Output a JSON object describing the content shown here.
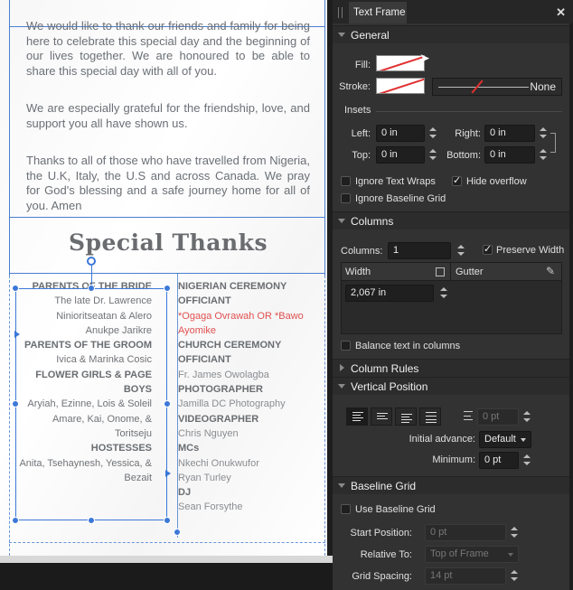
{
  "document": {
    "paragraphs": [
      "We would like to thank our friends and family for being here to celebrate this special day and the beginning of our lives together. We are honoured to be able to share this special day with all of you.",
      "We are especially grateful for the friendship, love, and support you all have shown us.",
      "Thanks to all of those who have travelled from Nigeria, the U.K, Italy, the U.S and across Canada. We pray for God's blessing and a safe journey home for all of you. Amen"
    ],
    "heading": "Special Thanks",
    "left_column": [
      {
        "text": "PARENTS OF THE BRIDE",
        "bold": true
      },
      {
        "text": "The late Dr. Lawrence",
        "bold": false
      },
      {
        "text": "Ninioritseatan & Alero",
        "bold": false
      },
      {
        "text": "Anukpe Jarikre",
        "bold": false
      },
      {
        "text": "PARENTS OF THE GROOM",
        "bold": true
      },
      {
        "text": "Ivica & Marinka Cosic",
        "bold": false
      },
      {
        "text": "FLOWER GIRLS & PAGE",
        "bold": true
      },
      {
        "text": "BOYS",
        "bold": true
      },
      {
        "text": "Aryiah, Ezinne, Lois & Soleil",
        "bold": false
      },
      {
        "text": "Amare, Kai, Onome, &",
        "bold": false
      },
      {
        "text": "Toritseju",
        "bold": false
      },
      {
        "text": "HOSTESSES",
        "bold": true
      },
      {
        "text": "Anita, Tsehaynesh, Yessica, &",
        "bold": false
      },
      {
        "text": "Bezait",
        "bold": false
      }
    ],
    "right_column": [
      {
        "text": "NIGERIAN CEREMONY",
        "style": "bold"
      },
      {
        "text": "OFFICIANT",
        "style": "bold"
      },
      {
        "text": "*Ogaga Ovrawah OR *Bawo",
        "style": "red"
      },
      {
        "text": "Ayomike",
        "style": "red"
      },
      {
        "text": "CHURCH CEREMONY",
        "style": "bold"
      },
      {
        "text": "OFFICIANT",
        "style": "bold"
      },
      {
        "text": "Fr. James Owolagba",
        "style": "normal"
      },
      {
        "text": "PHOTOGRAPHER",
        "style": "bold"
      },
      {
        "text": "Jamilla DC Photography",
        "style": "normal"
      },
      {
        "text": "VIDEOGRAPHER",
        "style": "bold"
      },
      {
        "text": "Chris Nguyen",
        "style": "normal"
      },
      {
        "text": "MCs",
        "style": "bold"
      },
      {
        "text": "Nkechi Onukwufor",
        "style": "normal"
      },
      {
        "text": "Ryan Turley",
        "style": "normal"
      },
      {
        "text": "DJ",
        "style": "bold"
      },
      {
        "text": "Sean Forsythe",
        "style": "normal"
      }
    ]
  },
  "panel": {
    "tab_title": "Text Frame",
    "general": {
      "title": "General",
      "fill_label": "Fill:",
      "stroke_label": "Stroke:",
      "stroke_style": "None",
      "insets_title": "Insets",
      "left_label": "Left:",
      "left_value": "0 in",
      "right_label": "Right:",
      "right_value": "0 in",
      "top_label": "Top:",
      "top_value": "0 in",
      "bottom_label": "Bottom:",
      "bottom_value": "0 in",
      "ignore_text_wraps": "Ignore Text Wraps",
      "hide_overflow": "Hide overflow",
      "ignore_baseline_grid": "Ignore Baseline Grid"
    },
    "columns": {
      "title": "Columns",
      "columns_label": "Columns:",
      "columns_value": "1",
      "preserve_width": "Preserve Width",
      "width_header": "Width",
      "gutter_header": "Gutter",
      "width_value": "2,067 in",
      "balance_text": "Balance text in columns"
    },
    "column_rules": {
      "title": "Column Rules"
    },
    "vertical_position": {
      "title": "Vertical Position",
      "baseline_value": "0 pt",
      "initial_advance_label": "Initial advance:",
      "initial_advance_value": "Default",
      "minimum_label": "Minimum:",
      "minimum_value": "0 pt"
    },
    "baseline_grid": {
      "title": "Baseline Grid",
      "use_baseline_grid": "Use Baseline Grid",
      "start_position_label": "Start Position:",
      "start_position_value": "0 pt",
      "relative_to_label": "Relative To:",
      "relative_to_value": "Top of Frame",
      "grid_spacing_label": "Grid Spacing:",
      "grid_spacing_value": "14 pt"
    }
  },
  "colors": {
    "selection": "#3c78d8",
    "accent_red": "#e05050",
    "panel_bg": "#323232"
  }
}
